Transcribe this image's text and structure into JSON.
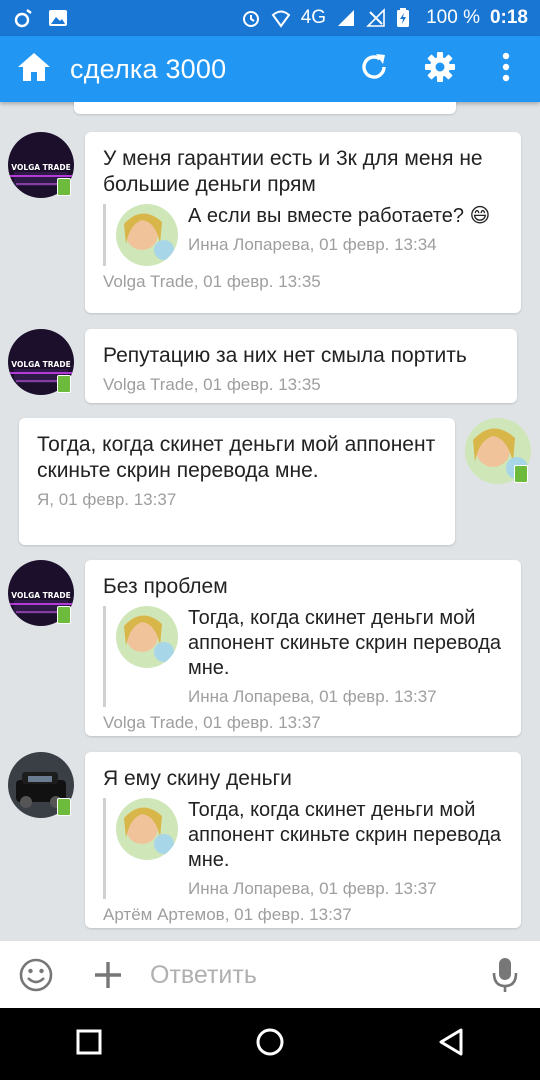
{
  "status_bar": {
    "network": "4G",
    "battery": "100 %",
    "time": "0:18",
    "icons": [
      "music-icon",
      "image-icon",
      "alarm-icon",
      "wifi-icon",
      "signal-icon",
      "no-signal-icon",
      "battery-icon"
    ]
  },
  "toolbar": {
    "title": "сделка 3000",
    "icons": [
      "home-icon",
      "refresh-icon",
      "settings-icon",
      "more-icon"
    ]
  },
  "messages": [
    {
      "author": "Volga Trade",
      "text": "У меня гарантии есть и 3к для меня не большие деньги прям",
      "meta": "Volga Trade, 01 февр. 13:35",
      "quote": {
        "text": "А если вы вместе работаете? 😄",
        "meta": "Инна Лопарева, 01 февр. 13:34"
      }
    },
    {
      "author": "Volga Trade",
      "text": "Репутацию за них нет смыла портить",
      "meta": "Volga Trade, 01 февр. 13:35"
    },
    {
      "author": "Я",
      "text": "Тогда, когда скинет деньги мой аппонент скиньте скрин перевода мне.",
      "meta": "Я, 01 февр. 13:37"
    },
    {
      "author": "Volga Trade",
      "text": "Без проблем",
      "meta": "Volga Trade, 01 февр. 13:37",
      "quote": {
        "text": "Тогда, когда скинет деньги мой аппонент скиньте скрин перевода мне.",
        "meta": "Инна Лопарева, 01 февр. 13:37"
      }
    },
    {
      "author": "Артём Артемов",
      "text": "Я ему скину деньги",
      "meta": "Артём Артемов, 01 февр. 13:37",
      "quote": {
        "text": "Тогда, когда скинет деньги мой аппонент скиньте скрин перевода мне.",
        "meta": "Инна Лопарева, 01 февр. 13:37"
      }
    }
  ],
  "avatar_labels": {
    "volga": "VOLGA TRADE"
  },
  "composer": {
    "placeholder": "Ответить",
    "icons": [
      "emoji-icon",
      "add-icon",
      "mic-icon"
    ]
  },
  "navbar": {
    "icons": [
      "recents-icon",
      "home-nav-icon",
      "back-icon"
    ]
  },
  "colors": {
    "status_bar": "#1976d2",
    "toolbar": "#2196f3",
    "background": "#dfe3e6",
    "online_badge": "#6cbb3c"
  }
}
